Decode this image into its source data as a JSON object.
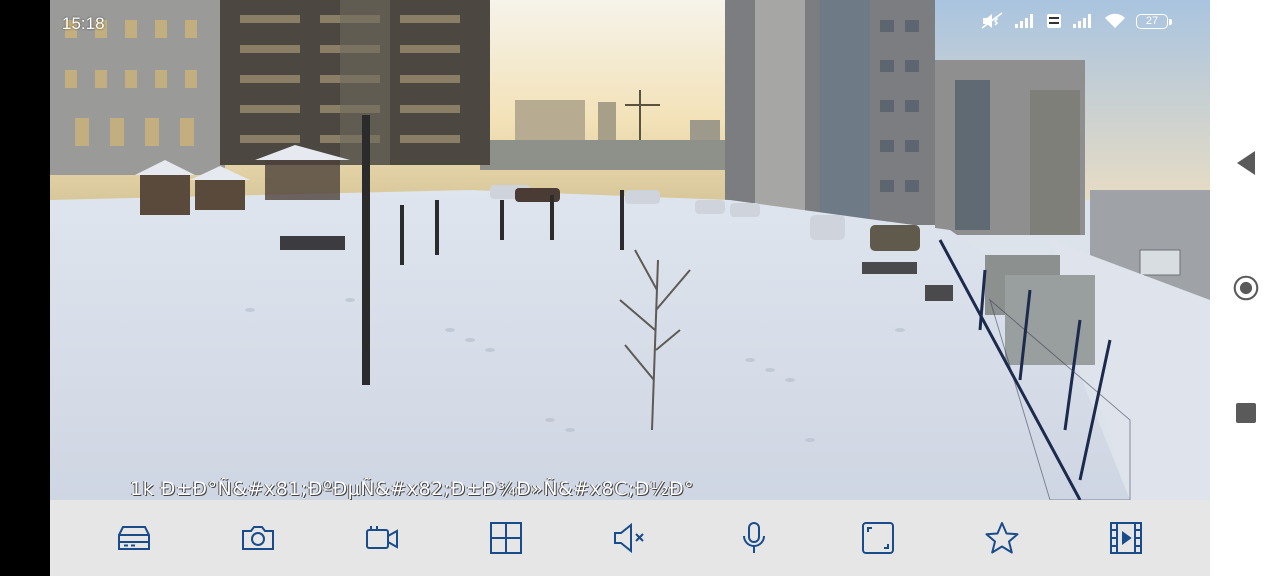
{
  "status_bar": {
    "time": "15:18",
    "battery_level": "27",
    "icons": [
      "mute-vibrate-icon",
      "signal-icon",
      "volte-icon",
      "signal-icon",
      "wifi-icon",
      "battery-icon"
    ]
  },
  "video": {
    "osd_text": "1k Ð±Ð°Ñ&#x81;ÐºÐµÑ&#x82;Ð±Ð¾Ð»Ñ&#x8C;Ð½Ð°"
  },
  "toolbar": {
    "icon_color": "#1a4c8c",
    "buttons": [
      "dvr-icon",
      "camera-icon",
      "video-record-icon",
      "grid-icon",
      "volume-mute-icon",
      "microphone-icon",
      "fullscreen-icon",
      "star-icon",
      "film-icon"
    ]
  },
  "nav_bar": {
    "buttons": [
      "back-icon",
      "home-icon",
      "recents-icon"
    ]
  }
}
